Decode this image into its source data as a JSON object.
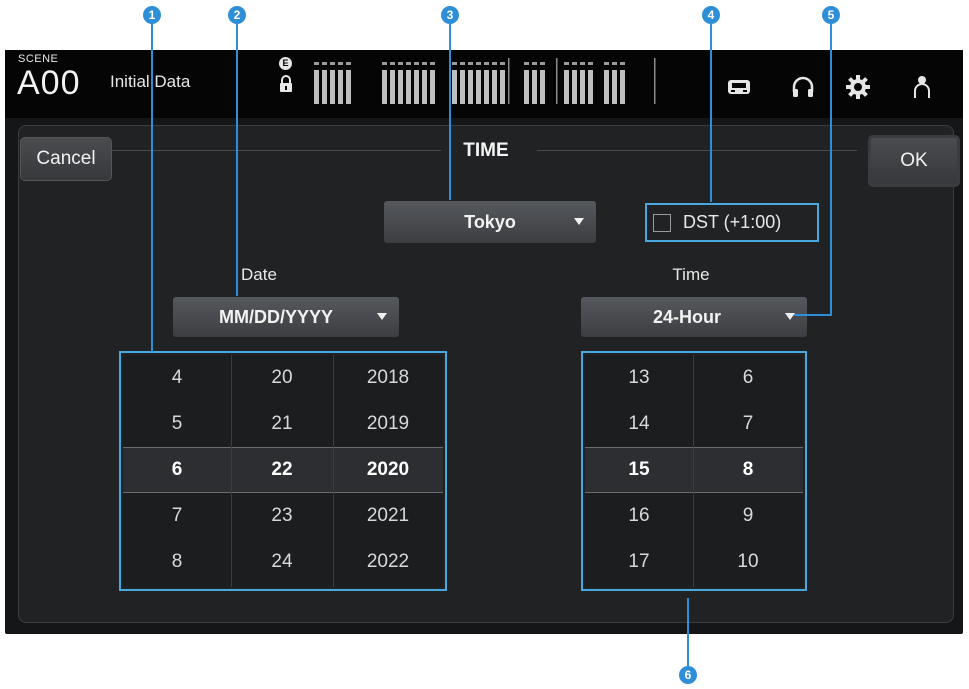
{
  "header": {
    "scene_label": "SCENE",
    "scene_number": "A00",
    "scene_name": "Initial Data",
    "badge": "E"
  },
  "dialog": {
    "title": "TIME",
    "cancel_label": "Cancel",
    "ok_label": "OK",
    "timezone": "Tokyo",
    "dst_label": "DST (+1:00)",
    "dst_checked": false,
    "date_label": "Date",
    "date_format": "MM/DD/YYYY",
    "time_label": "Time",
    "time_format": "24-Hour"
  },
  "date_picker": {
    "month": [
      "4",
      "5",
      "6",
      "7",
      "8"
    ],
    "day": [
      "20",
      "21",
      "22",
      "23",
      "24"
    ],
    "year": [
      "2018",
      "2019",
      "2020",
      "2021",
      "2022"
    ],
    "selected_index": 2
  },
  "time_picker": {
    "hour": [
      "13",
      "14",
      "15",
      "16",
      "17"
    ],
    "minute": [
      "6",
      "7",
      "8",
      "9",
      "10"
    ],
    "selected_index": 2
  },
  "callouts": [
    "1",
    "2",
    "3",
    "4",
    "5",
    "6"
  ],
  "colors": {
    "highlight": "#4aa8e0",
    "callout": "#2f8fd6",
    "background": "#202224"
  }
}
